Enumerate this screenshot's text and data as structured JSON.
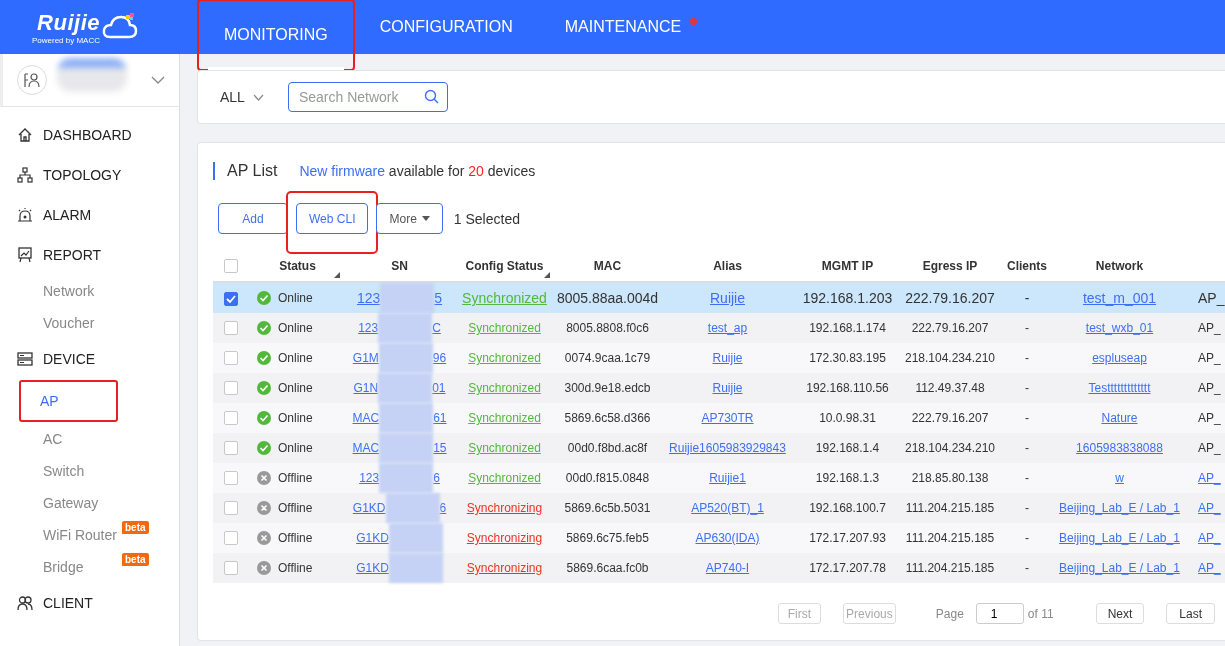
{
  "header": {
    "logo": "Ruijie",
    "logo_sub": "Powered by MACC",
    "tabs": [
      {
        "label": "MONITORING",
        "selected": true,
        "highlighted": true,
        "notification": false
      },
      {
        "label": "CONFIGURATION",
        "selected": false,
        "highlighted": false,
        "notification": false
      },
      {
        "label": "MAINTENANCE",
        "selected": false,
        "highlighted": false,
        "notification": true
      }
    ]
  },
  "sidebar": {
    "items": [
      {
        "label": "DASHBOARD"
      },
      {
        "label": "TOPOLOGY"
      },
      {
        "label": "ALARM"
      },
      {
        "label": "REPORT",
        "children": [
          {
            "label": "Network",
            "selected": false,
            "highlighted": false
          },
          {
            "label": "Voucher",
            "selected": false,
            "highlighted": false
          }
        ]
      },
      {
        "label": "DEVICE",
        "children": [
          {
            "label": "AP",
            "selected": true,
            "highlighted": true
          },
          {
            "label": "AC",
            "selected": false,
            "highlighted": false
          },
          {
            "label": "Switch",
            "selected": false,
            "highlighted": false
          },
          {
            "label": "Gateway",
            "selected": false,
            "highlighted": false
          },
          {
            "label": "WiFi Router",
            "selected": false,
            "highlighted": false,
            "badge": "beta"
          },
          {
            "label": "Bridge",
            "selected": false,
            "highlighted": false,
            "badge": "beta"
          }
        ]
      },
      {
        "label": "CLIENT"
      }
    ]
  },
  "filter": {
    "scope": "ALL",
    "search": {
      "placeholder": "Search Network"
    }
  },
  "ap_list": {
    "title": "AP List",
    "notice": {
      "link": "New firmware",
      "text_1": " available for ",
      "count": "20",
      "text_2": " devices"
    },
    "buttons": [
      {
        "label": "Add",
        "kind": "plain",
        "highlighted": false
      },
      {
        "label": "Web CLI",
        "kind": "plain",
        "highlighted": true
      },
      {
        "label": "More",
        "kind": "dropdown",
        "highlighted": false
      }
    ],
    "selected_count": "1 Selected",
    "all_selected": false,
    "columns": [
      {
        "label": "Status",
        "sortable": true
      },
      {
        "label": "SN",
        "sortable": false
      },
      {
        "label": "Config Status",
        "sortable": true
      },
      {
        "label": "MAC",
        "sortable": false
      },
      {
        "label": "Alias",
        "sortable": false
      },
      {
        "label": "MGMT IP",
        "sortable": false
      },
      {
        "label": "Egress IP",
        "sortable": false
      },
      {
        "label": "Clients",
        "sortable": false
      },
      {
        "label": "Network",
        "sortable": false
      }
    ],
    "rows": [
      {
        "selected": true,
        "status": "Online",
        "online": true,
        "sn_start": "123",
        "sn_end": "5",
        "config_status": "Synchronized",
        "synced": true,
        "mac": "8005.88aa.004d",
        "alias": "Ruijie",
        "mgmt_ip": "192.168.1.203",
        "egress_ip": "222.79.16.207",
        "clients": "-",
        "network": "test_m_001",
        "column_11": "AP_",
        "column_11_link": false
      },
      {
        "selected": false,
        "status": "Online",
        "online": true,
        "sn_start": "123",
        "sn_end": "C",
        "config_status": "Synchronized",
        "synced": true,
        "mac": "8005.8808.f0c6",
        "alias": "test_ap",
        "mgmt_ip": "192.168.1.174",
        "egress_ip": "222.79.16.207",
        "clients": "-",
        "network": "test_wxb_01",
        "column_11": "AP_",
        "column_11_link": false
      },
      {
        "selected": false,
        "status": "Online",
        "online": true,
        "sn_start": "G1M",
        "sn_end": "96",
        "config_status": "Synchronized",
        "synced": true,
        "mac": "0074.9caa.1c79",
        "alias": "Ruijie",
        "mgmt_ip": "172.30.83.195",
        "egress_ip": "218.104.234.210",
        "clients": "-",
        "network": "espluseap",
        "column_11": "AP_",
        "column_11_link": false
      },
      {
        "selected": false,
        "status": "Online",
        "online": true,
        "sn_start": "G1N",
        "sn_end": "01",
        "config_status": "Synchronized",
        "synced": true,
        "mac": "300d.9e18.edcb",
        "alias": "Ruijie",
        "mgmt_ip": "192.168.110.56",
        "egress_ip": "112.49.37.48",
        "clients": "-",
        "network": "Testtttttttttttt",
        "column_11": "AP_",
        "column_11_link": false
      },
      {
        "selected": false,
        "status": "Online",
        "online": true,
        "sn_start": "MAC",
        "sn_end": "61",
        "config_status": "Synchronized",
        "synced": true,
        "mac": "5869.6c58.d366",
        "alias": "AP730TR",
        "mgmt_ip": "10.0.98.31",
        "egress_ip": "222.79.16.207",
        "clients": "-",
        "network": "Nature",
        "column_11": "AP_",
        "column_11_link": false
      },
      {
        "selected": false,
        "status": "Online",
        "online": true,
        "sn_start": "MAC",
        "sn_end": "15",
        "config_status": "Synchronized",
        "synced": true,
        "mac": "00d0.f8bd.ac8f",
        "alias": "Ruijie1605983929843",
        "mgmt_ip": "192.168.1.4",
        "egress_ip": "218.104.234.210",
        "clients": "-",
        "network": "1605983838088",
        "column_11": "AP_",
        "column_11_link": false
      },
      {
        "selected": false,
        "status": "Offline",
        "online": false,
        "sn_start": "123",
        "sn_end": "6",
        "config_status": "Synchronized",
        "synced": true,
        "mac": "00d0.f815.0848",
        "alias": "Ruijie1",
        "mgmt_ip": "192.168.1.3",
        "egress_ip": "218.85.80.138",
        "clients": "-",
        "network": "w",
        "column_11": "AP_",
        "column_11_link": true
      },
      {
        "selected": false,
        "status": "Offline",
        "online": false,
        "sn_start": "G1KD",
        "sn_end": "6",
        "config_status": "Synchronizing",
        "synced": false,
        "mac": "5869.6c5b.5031",
        "alias": "AP520(BT)_1",
        "mgmt_ip": "192.168.100.7",
        "egress_ip": "111.204.215.185",
        "clients": "-",
        "network": "Beijing_Lab_E / Lab_1",
        "column_11": "AP_",
        "column_11_link": true
      },
      {
        "selected": false,
        "status": "Offline",
        "online": false,
        "sn_start": "G1KD",
        "config_status": "Synchronizing",
        "synced": false,
        "mac": "5869.6c75.feb5",
        "alias": "AP630(IDA)",
        "mgmt_ip": "172.17.207.93",
        "egress_ip": "111.204.215.185",
        "clients": "-",
        "network": "Beijing_Lab_E / Lab_1",
        "column_11": "AP_",
        "column_11_link": true
      },
      {
        "selected": false,
        "status": "Offline",
        "online": false,
        "sn_start": "G1KD",
        "config_status": "Synchronizing",
        "synced": false,
        "mac": "5869.6caa.fc0b",
        "alias": "AP740-I",
        "mgmt_ip": "172.17.207.78",
        "egress_ip": "111.204.215.185",
        "clients": "-",
        "network": "Beijing_Lab_E / Lab_1",
        "column_11": "AP_",
        "column_11_link": true
      }
    ],
    "pagination": {
      "first": {
        "label": "First",
        "disabled": true
      },
      "previous": {
        "label": "Previous",
        "disabled": true
      },
      "page_label": "Page",
      "page": "1",
      "total": "of 11",
      "next": {
        "label": "Next",
        "disabled": false
      },
      "last": {
        "label": "Last",
        "disabled": false
      }
    }
  }
}
